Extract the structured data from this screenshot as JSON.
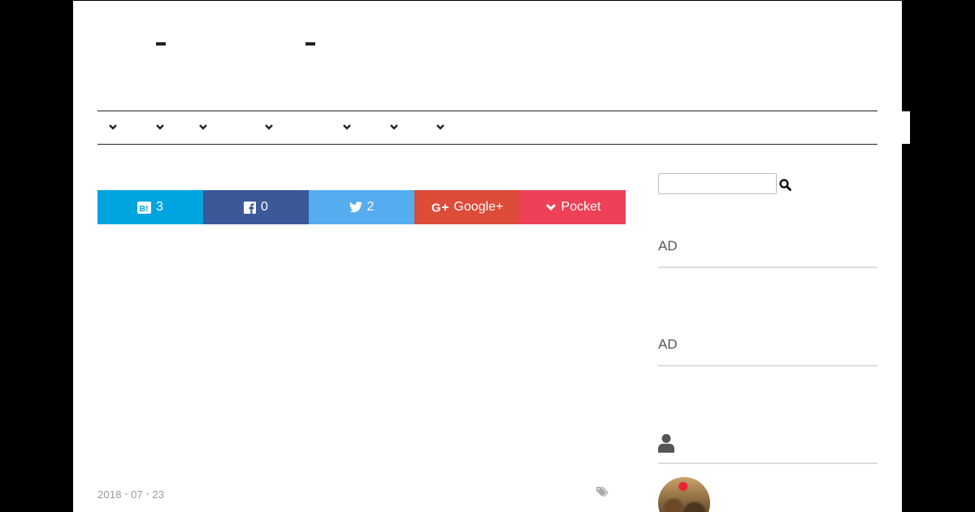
{
  "share": {
    "hatena": {
      "icon": "hatena-bookmark-icon",
      "count": "3",
      "color": "#00a4de"
    },
    "facebook": {
      "icon": "facebook-icon",
      "count": "0",
      "color": "#3b5998"
    },
    "twitter": {
      "icon": "twitter-icon",
      "count": "2",
      "color": "#55acee"
    },
    "googleplus": {
      "icon": "google-plus-icon",
      "label": "Google+",
      "color": "#dd4b39"
    },
    "pocket": {
      "icon": "pocket-chevron-icon",
      "label": "Pocket",
      "color": "#ee4056"
    }
  },
  "post": {
    "date_year": "2018",
    "date_month": "07",
    "date_day": "23",
    "tag_icon": "tag-icon"
  },
  "sidebar": {
    "search": {
      "value": "",
      "icon": "search-icon"
    },
    "widgets": {
      "ad1": "AD",
      "ad2": "AD",
      "profile_icon": "user-icon"
    }
  }
}
